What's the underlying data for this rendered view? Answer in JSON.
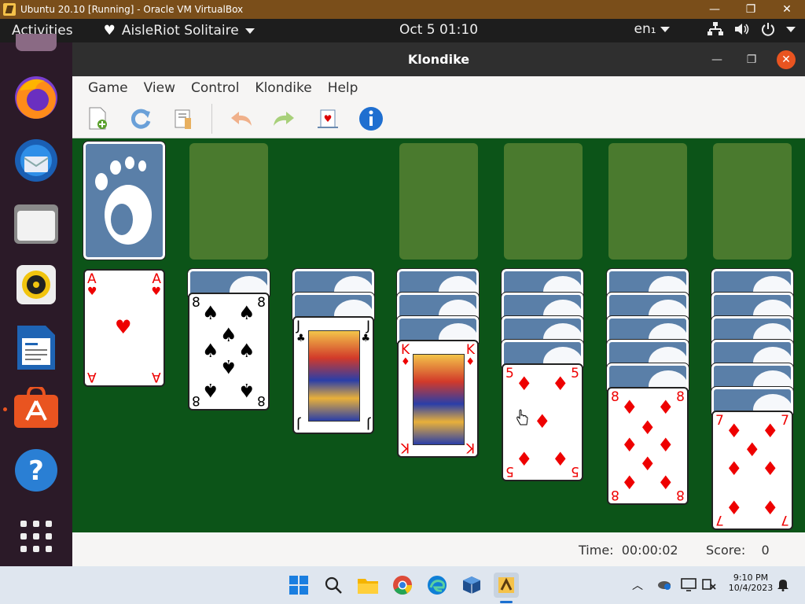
{
  "host": {
    "title": "Ubuntu 20.10 [Running] - Oracle VM VirtualBox",
    "controls": [
      "—",
      "❐",
      "✕"
    ]
  },
  "topbar": {
    "activities": "Activities",
    "app_name": "AisleRiot Solitaire",
    "clock": "Oct 5  01:10",
    "input_lang": "en₁"
  },
  "window": {
    "title": "Klondike",
    "menu": [
      "Game",
      "View",
      "Control",
      "Klondike",
      "Help"
    ]
  },
  "cards": {
    "ace_hearts": "A",
    "eight_spades": "8",
    "jack_clubs": "J",
    "king_diamonds": "K",
    "five_diamonds": "5",
    "eight_diamonds": "8",
    "seven_diamonds": "7"
  },
  "status": {
    "time_label": "Time:",
    "time_value": "00:00:02",
    "score_label": "Score:",
    "score_value": "0"
  },
  "taskbar": {
    "time": "9:10 PM",
    "date": "10/4/2023"
  },
  "colors": {
    "felt": "#0c5418",
    "accent": "#e95420",
    "card_back": "#5a7fa8"
  }
}
